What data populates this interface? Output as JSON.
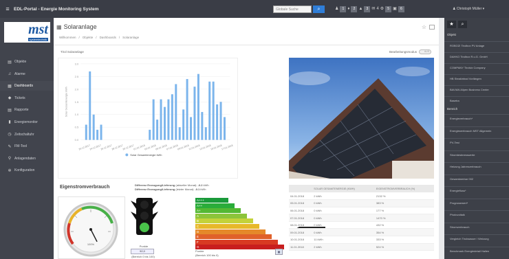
{
  "app": {
    "title": "EDL-Portal - Energie Monitoring System",
    "search_placeholder": "Globale Suche",
    "toolbar": [
      "1",
      "2",
      "3",
      "4",
      "5",
      "6",
      "7"
    ],
    "user": "Christoph Müller"
  },
  "logo": {
    "text": "mst",
    "sub": "systemtechnik"
  },
  "nav": [
    {
      "label": "Objekte",
      "icon": "building-icon"
    },
    {
      "label": "Alarme",
      "icon": "bell-icon"
    },
    {
      "label": "Dashboards",
      "icon": "grid-icon"
    },
    {
      "label": "Tickets",
      "icon": "ticket-icon"
    },
    {
      "label": "Rapporte",
      "icon": "file-icon"
    },
    {
      "label": "Energiemonitor",
      "icon": "bar-chart-icon"
    },
    {
      "label": "Zeitschaltuhr",
      "icon": "clock-icon"
    },
    {
      "label": "FM-Tool",
      "icon": "wrench-icon"
    },
    {
      "label": "Anlagendaten",
      "icon": "car-icon"
    },
    {
      "label": "Konfiguration",
      "icon": "cogs-icon"
    }
  ],
  "page": {
    "title": "Solaranlage",
    "breadcrumbs": [
      "Willkommen",
      "Objekte",
      "Dashboards",
      "Solaranlage"
    ],
    "chart_title": "Tirol Solaranlage",
    "edit_mode_label": "Bearbeitungsmodus",
    "edit_mode_value": "AUS"
  },
  "chart_data": {
    "type": "bar",
    "categories": [
      "20.12.2017",
      "21.12.2017",
      "22.12.2017",
      "23.12.2017",
      "24.12.2017",
      "25.12.2017",
      "26.12.2017",
      "27.12.2017",
      "28.12.2017",
      "29.12.2017",
      "30.12.2017",
      "31.12.2017",
      "01.01.2018",
      "02.01.2018",
      "03.01.2018",
      "04.01.2018",
      "05.01.2018",
      "06.01.2018",
      "07.01.2018",
      "08.01.2018",
      "09.01.2018",
      "10.01.2018",
      "11.01.2018",
      "12.01.2018",
      "13.01.2018",
      "14.01.2018",
      "15.01.2018",
      "16.01.2018",
      "17.01.2018",
      "18.01.2018",
      "19.01.2018",
      "20.01.2018",
      "21.01.2018",
      "22.01.2018",
      "23.01.2018",
      "24.01.2018",
      "25.01.2018",
      "26.01.2018",
      "27.01.2018",
      "28.01.2018"
    ],
    "series": [
      {
        "name": "Solar Gesamtenergie kWh",
        "values": [
          0,
          0.6,
          2.7,
          1.0,
          0.4,
          0.6,
          0,
          0,
          0,
          0,
          0,
          0,
          0,
          0,
          0,
          0,
          0,
          0,
          0.4,
          1.6,
          0.8,
          1.6,
          1.3,
          1.6,
          1.8,
          2.2,
          0.5,
          1.2,
          2.4,
          0.9,
          2.1,
          2.6,
          1.1,
          0.5,
          2.3,
          2.3,
          1.4,
          1.5,
          0.9,
          0
        ]
      }
    ],
    "tick_labels": [
      "26.12.2017",
      "24.12.2017",
      "26.12.2017",
      "28.12.2017",
      "30.12.2017",
      "01.01.2018",
      "03.01.2018",
      "05.01.2018",
      "07.01.2018",
      "09.01.2018",
      "11.01.2018",
      "13.01.2018",
      "15.01.2018",
      "17.01.2018"
    ],
    "y_ticks": [
      "0.0",
      "0.5",
      "1.0",
      "1.5",
      "2.0",
      "2.5",
      "3.0"
    ],
    "ylabel": "Solar Gesamtenergie kWh",
    "ylim": [
      0,
      3.0
    ],
    "color": "#7cb5ec",
    "legend": "bottom"
  },
  "eigen": {
    "title": "Eigenstromverbrauch",
    "diff1_label": "Differenz Erzeugung/Lieferung",
    "diff1_suffix": "(aktueller Monat):",
    "diff1_value": "-0.2",
    "diff1_unit": "kWh",
    "diff2_label": "Differenz Erzeugung/Lieferung",
    "diff2_suffix": "(letzter Monat):",
    "diff2_value": "-0.1",
    "diff2_unit": "kWh",
    "gauge_label": "100%",
    "gauge_value": 0.6,
    "punkte_label": "Punkte",
    "punkte_value": "92,0",
    "range1": "(Bereich 0 bis 100)",
    "punkte2_label": "Punkte",
    "range2": "(Bereich 100 bis 0)",
    "energy_classes": [
      "A+++",
      "A++",
      "A+",
      "A",
      "B",
      "C",
      "D",
      "E",
      "F",
      "G"
    ],
    "energy_colors": [
      "#1a9a3a",
      "#2aac3a",
      "#54b833",
      "#8cc43a",
      "#c3d23a",
      "#e7b82a",
      "#e5892a",
      "#e0612a",
      "#d83a22",
      "#c81e1e"
    ],
    "current_class": "B",
    "btn_label": "▦"
  },
  "table": {
    "headers": [
      "",
      "SOLAR GESAMTENERGIE (KWH)",
      "EIGENSTROMVERBRAUCH (%)"
    ],
    "rows": [
      [
        "04.01.2018",
        "2 kWh",
        "2132 %"
      ],
      [
        "05.01.2018",
        "0 kWh",
        "383 %"
      ],
      [
        "06.01.2018",
        "0 kWh",
        "177 %"
      ],
      [
        "07.01.2018",
        "0 kWh",
        "1470 %"
      ],
      [
        "08.01.2018",
        "0 kWh",
        "432 %"
      ],
      [
        "09.01.2018",
        "0 kWh",
        "354 %"
      ],
      [
        "10.01.2018",
        "11 kWh",
        "333 %"
      ],
      [
        "11.01.2018",
        "2 kWh",
        "524 %"
      ]
    ]
  },
  "rightbar": {
    "section1": "Objekt",
    "objects": [
      "ROBOZI Tirolbox PV Anlage",
      "DAHKO Tirolbox R.u.G. GmbH",
      "COMPANY Tirolviz Company",
      "HB Steakinbad Vorlängen",
      "BAVIAN Allpen Business Center",
      "Basetra"
    ],
    "section2": "Bereich",
    "areas": [
      "Energieverbrauch*",
      "Energiewerbrauch MST Allgemein",
      "PV-Test",
      "Stromtestmesswerte",
      "Heizung Jahresverbrauch",
      "Gesamtwerbar 002",
      "Energiefluss*",
      "Prognosewert*",
      "Photovoltaik",
      "Stromverbrauch",
      "Vergleich Tirolwasser / Weizung",
      "Benchmark Energiedetail Hallen"
    ]
  }
}
